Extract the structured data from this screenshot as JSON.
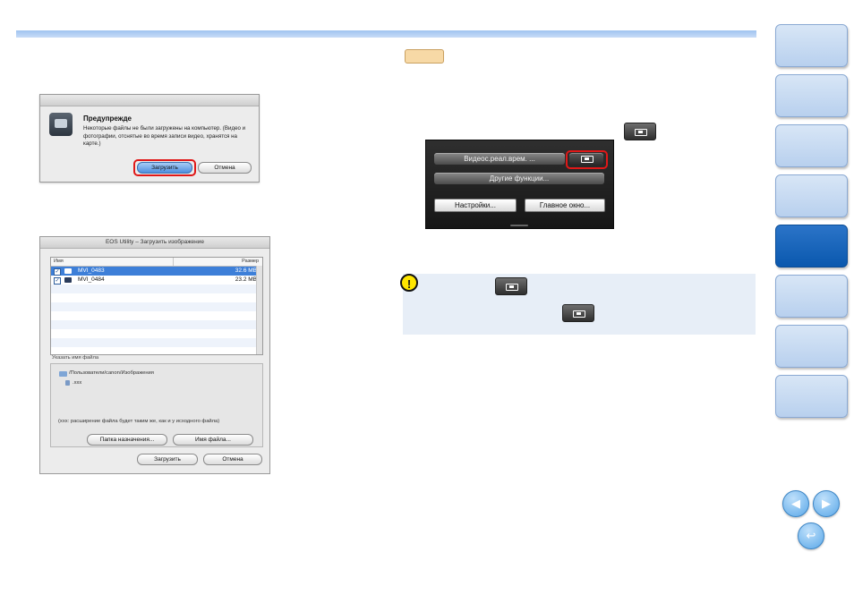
{
  "dialog_warning": {
    "title": "Предупрежде",
    "message": "Некоторые файлы не были загружены на компьютер. (Видео и фотографии, отснятые во время записи видео, хранятся на карте.)",
    "download_button": "Загрузить",
    "cancel_button": "Отмена"
  },
  "dialog_download": {
    "window_title": "EOS Utility – Загрузить изображение",
    "col_name": "Имя",
    "col_size": "Размер",
    "files": [
      {
        "name": "MVI_0483",
        "size": "32.6 MB",
        "checked": "✓"
      },
      {
        "name": "MVI_0484",
        "size": "23.2 MB",
        "checked": "✓"
      }
    ],
    "section_label": "Указать имя файла",
    "path": "/Пользователи/canon/Изображения",
    "extension": ".xxx",
    "note": "(xxx: расширение файла будет таким же, как и у исходного файла)",
    "dest_folder_button": "Папка назначения...",
    "file_name_button": "Имя файла...",
    "download_button": "Загрузить",
    "cancel_button": "Отмена"
  },
  "camera_panel": {
    "live_view_button": "Видеос.реал.врем. ...",
    "other_functions": "Другие функции...",
    "settings_button": "Настройки...",
    "main_window_button": "Главное окно..."
  },
  "colors": {
    "accent_blue": "#0a58ae",
    "highlight_red": "#e01818",
    "caution_bg": "#e7eef7"
  }
}
